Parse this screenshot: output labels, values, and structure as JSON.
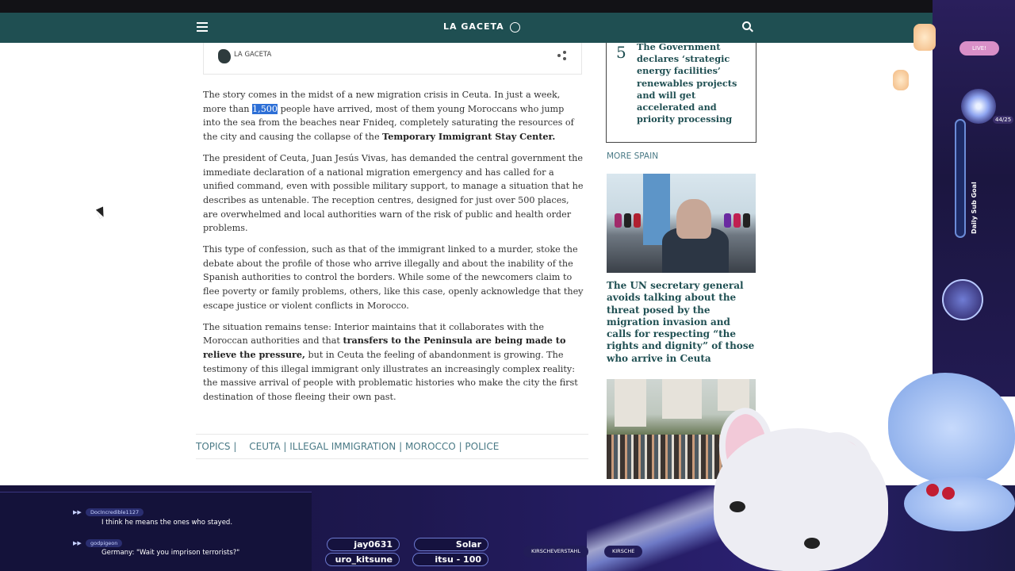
{
  "site": {
    "logo_text": "LA GACETA"
  },
  "author": {
    "name": "LA GACETA"
  },
  "article": {
    "p1_a": "The story comes in the midst of a new migration crisis in Ceuta. In just a week, more than ",
    "p1_hl": "1,500",
    "p1_b": " people have arrived, most of them young Moroccans who jump into the sea from the beaches near Fnideq, completely saturating the resources of the city and causing the collapse of the ",
    "p1_bold": "Temporary Immigrant Stay Center.",
    "p2": "The president of Ceuta, Juan Jesús Vivas, has demanded the central government the immediate declaration of a national migration emergency and has called for a unified command, even with possible military support, to manage a situation that he describes as untenable. The reception centres, designed for just over 500 places, are overwhelmed and local authorities warn of the risk of public and health order problems.",
    "p3": "This type of confession, such as that of the immigrant linked to a murder, stoke the debate about the profile of those who arrive illegally and about the inability of the Spanish authorities to control the borders. While some of the newcomers claim to flee poverty or family problems, others, like this case, openly acknowledge that they escape justice or violent conflicts in Morocco.",
    "p4_a": "The situation remains tense: Interior maintains that it collaborates with the Moroccan authorities and that ",
    "p4_bold": "transfers to the Peninsula are being made to relieve the pressure,",
    "p4_b": " but in Ceuta the feeling of abandonment is growing. The testimony of this illegal immigrant only illustrates an increasingly complex reality: the massive arrival of people with problematic histories who make the city the first destination of those fleeing their own past."
  },
  "topics": {
    "label": "TOPICS |",
    "tags": [
      "CEUTA",
      "ILLEGAL IMMIGRATION",
      "MOROCCO",
      "POLICE"
    ],
    "sep": " | "
  },
  "sidebar": {
    "top_number": "5",
    "top_title": "The Government declares ‘strategic energy facilities’ renewables projects and will get accelerated and priority processing",
    "more_heading": "MORE SPAIN",
    "news_title": "The UN secretary general avoids talking about the threat posed by the migration invasion and calls for respecting “the rights and dignity” of those who arrive in Ceuta"
  },
  "overlay": {
    "live": "LIVE!",
    "goal_label": "Daily Sub Goal",
    "goal_count": "44/25",
    "chat": [
      {
        "user": "DocIncredible1127",
        "message": "I think he means the ones who stayed."
      },
      {
        "user": "godpigeon",
        "message": "Germany: \"Wait you imprison terrorists?\""
      }
    ],
    "ribbons": [
      "jay0631",
      "Solar",
      "uro_kitsune",
      "itsu - 100"
    ],
    "socials": [
      "KIRSCHEVERSTAHL",
      "KIRSCHE"
    ]
  },
  "colors": {
    "header": "#1f4f52",
    "accent": "#4a7a86",
    "highlight": "#2d6fd6"
  }
}
